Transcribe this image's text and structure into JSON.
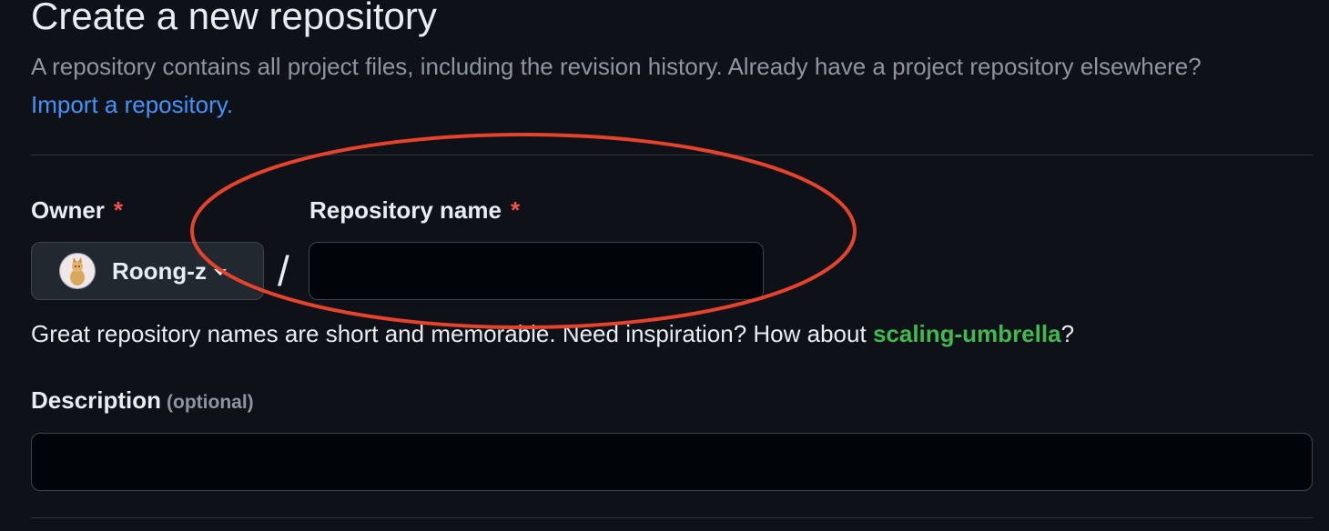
{
  "header": {
    "title": "Create a new repository",
    "description": "A repository contains all project files, including the revision history. Already have a project repository elsewhere?",
    "import_link": "Import a repository."
  },
  "owner": {
    "label": "Owner",
    "required_mark": "*",
    "selected": "Roong-z",
    "avatar_icon": "cat-avatar"
  },
  "separator": "/",
  "repository_name": {
    "label": "Repository name",
    "required_mark": "*",
    "value": ""
  },
  "hint": {
    "text": "Great repository names are short and memorable. Need inspiration? How about",
    "suggestion": "scaling-umbrella",
    "end": "?"
  },
  "description_field": {
    "label": "Description",
    "optional": "(optional)",
    "value": ""
  },
  "colors": {
    "background": "#0e1117",
    "link": "#4493f8",
    "suggestion": "#3fb950",
    "required": "#f85149",
    "annotation": "#e5432b"
  }
}
